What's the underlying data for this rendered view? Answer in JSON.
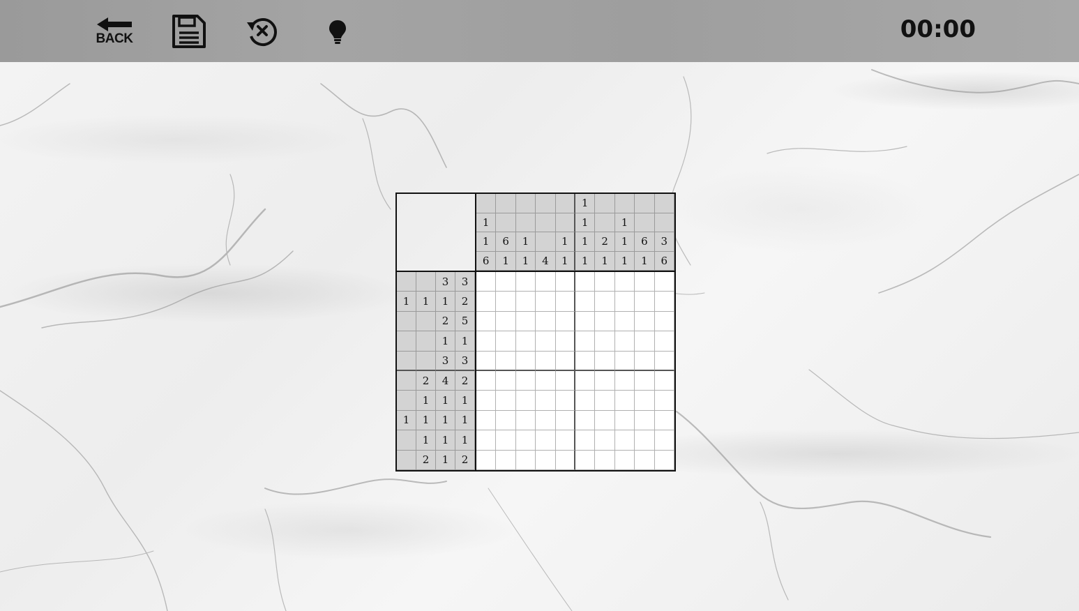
{
  "toolbar": {
    "back_label": "BACK",
    "timer": "00:00"
  },
  "puzzle": {
    "column_clues": [
      [
        "",
        "1",
        "1",
        "6"
      ],
      [
        "",
        "",
        "6",
        "1"
      ],
      [
        "",
        "",
        "1",
        "1"
      ],
      [
        "",
        "",
        "",
        "4"
      ],
      [
        "",
        "",
        "1",
        "1"
      ],
      [
        "1",
        "1",
        "1",
        "1"
      ],
      [
        "",
        "",
        "2",
        "1"
      ],
      [
        "",
        "1",
        "1",
        "1"
      ],
      [
        "",
        "",
        "6",
        "1"
      ],
      [
        "",
        "",
        "3",
        "6"
      ]
    ],
    "row_clues": [
      [
        "",
        "",
        "3",
        "3"
      ],
      [
        "1",
        "1",
        "1",
        "2"
      ],
      [
        "",
        "",
        "2",
        "5"
      ],
      [
        "",
        "",
        "1",
        "1"
      ],
      [
        "",
        "",
        "3",
        "3"
      ],
      [
        "",
        "2",
        "4",
        "2"
      ],
      [
        "",
        "1",
        "1",
        "1"
      ],
      [
        "1",
        "1",
        "1",
        "1"
      ],
      [
        "",
        "1",
        "1",
        "1"
      ],
      [
        "",
        "2",
        "1",
        "2"
      ]
    ]
  }
}
